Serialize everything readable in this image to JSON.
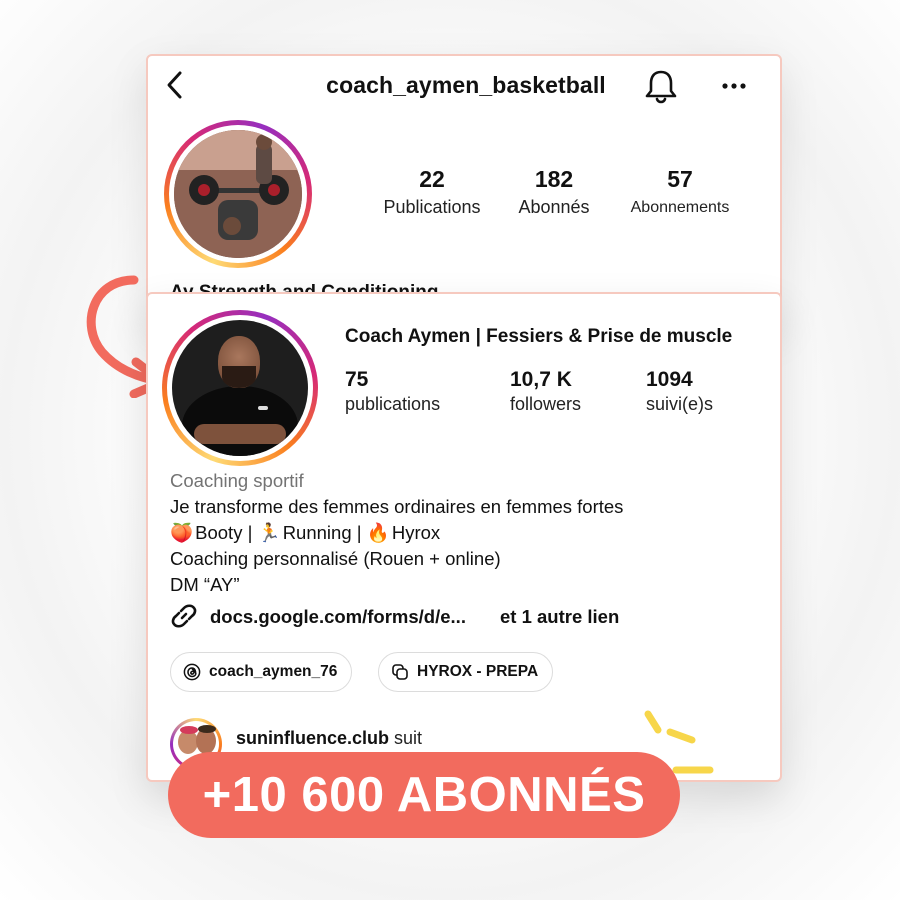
{
  "old_profile": {
    "username": "coach_aymen_basketball",
    "icons": {
      "back": "chevron-left-icon",
      "bell": "bell-icon",
      "more": "more-horizontal-icon"
    },
    "stats": [
      {
        "value": "22",
        "label": "Publications"
      },
      {
        "value": "182",
        "label": "Abonnés"
      },
      {
        "value": "57",
        "label": "Abonnements"
      }
    ],
    "bio_partial": "Ay  Strength  and  Conditioning"
  },
  "new_profile": {
    "name": "Coach Aymen | Fessiers & Prise de muscle",
    "stats": [
      {
        "value": "75",
        "label": "publications"
      },
      {
        "value": "10,7 K",
        "label": "followers"
      },
      {
        "value": "1094",
        "label": "suivi(e)s"
      }
    ],
    "category": "Coaching sportif",
    "bio_lines": [
      "Je transforme des femmes ordinaires en femmes fortes",
      "Booty | ",
      "Running | ",
      "Hyrox",
      "Coaching personnalisé (Rouen + online)",
      "DM “AY”"
    ],
    "emojis": [
      "🍑",
      "🏃",
      "🔥"
    ],
    "link": {
      "text": "docs.google.com/forms/d/e...",
      "extra": "et 1 autre lien"
    },
    "chips": [
      {
        "label": "coach_aymen_76",
        "icon": "threads-icon"
      },
      {
        "label": "HYROX - PREPA",
        "icon": "highlight-icon"
      }
    ],
    "followed_by": {
      "account": "suninfluence.club",
      "suffix": "suit"
    }
  },
  "badge": "+10 600 ABONNÉS",
  "colors": {
    "accent": "#f26b5e",
    "card_border": "#f6c9bf",
    "story_ring": [
      "#feda75",
      "#fa7e1e",
      "#d62976",
      "#962fbf"
    ],
    "sparkle": "#f7d64a"
  }
}
